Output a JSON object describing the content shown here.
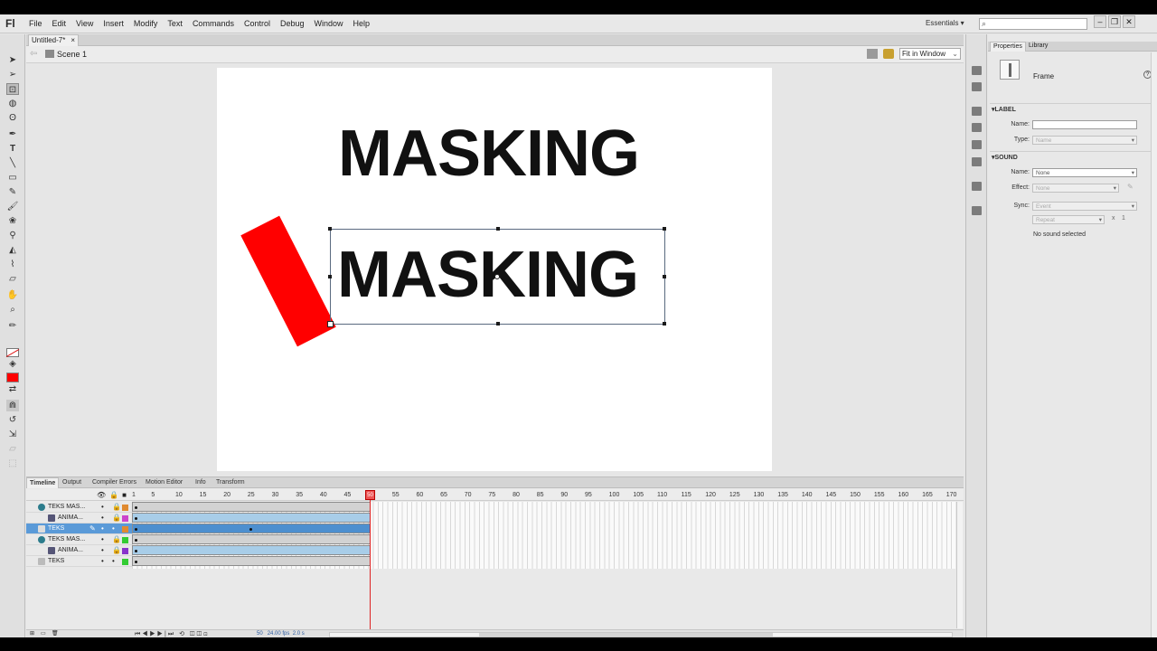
{
  "app": {
    "logo": "Fl"
  },
  "menu": [
    "File",
    "Edit",
    "View",
    "Insert",
    "Modify",
    "Text",
    "Commands",
    "Control",
    "Debug",
    "Window",
    "Help"
  ],
  "workspace": "Essentials ▾",
  "doc_tab": {
    "name": "Untitled-7*",
    "close": "×"
  },
  "editbar": {
    "scene": "Scene 1",
    "zoom": "Fit in Window"
  },
  "stage": {
    "text_top": "MASKING",
    "text_mid": "MASKING",
    "rect_color": "#ff0000"
  },
  "panel_tabs": [
    "Timeline",
    "Output",
    "Compiler Errors",
    "Motion Editor",
    "Info",
    "Transform"
  ],
  "frame_numbers": [
    "1",
    "5",
    "10",
    "15",
    "20",
    "25",
    "30",
    "35",
    "40",
    "45",
    "50",
    "55",
    "60",
    "65",
    "70",
    "75",
    "80",
    "85",
    "90",
    "95",
    "100",
    "105",
    "110",
    "115",
    "120",
    "125",
    "130",
    "135",
    "140",
    "145",
    "150",
    "155",
    "160",
    "165",
    "170"
  ],
  "playhead_frame": "50",
  "layers": [
    {
      "name": "TEKS MAS...",
      "type": "mask",
      "color": "#e08a30"
    },
    {
      "name": "ANIMA...",
      "type": "masked",
      "color": "#cc44cc"
    },
    {
      "name": "TEKS",
      "type": "normal",
      "color": "#e08a30",
      "selected": true
    },
    {
      "name": "TEKS MAS...",
      "type": "mask",
      "color": "#33cc33"
    },
    {
      "name": "ANIMA...",
      "type": "masked",
      "color": "#8833cc"
    },
    {
      "name": "TEKS",
      "type": "normal",
      "color": "#33cc33"
    }
  ],
  "timeline_status": {
    "frame": "50",
    "fps": "24.00 fps",
    "time": "2.0 s"
  },
  "properties": {
    "tabs": [
      "Properties",
      "Library"
    ],
    "object": "Frame",
    "label_section": "LABEL",
    "name_label": "Name:",
    "type_label": "Type:",
    "type_value": "Name",
    "sound_section": "SOUND",
    "sound_name_label": "Name:",
    "sound_name_value": "None",
    "effect_label": "Effect:",
    "effect_value": "None",
    "sync_label": "Sync:",
    "sync_value": "Event",
    "repeat_value": "Repeat",
    "repeat_x": "x",
    "repeat_count": "1",
    "no_sound": "No sound selected"
  }
}
